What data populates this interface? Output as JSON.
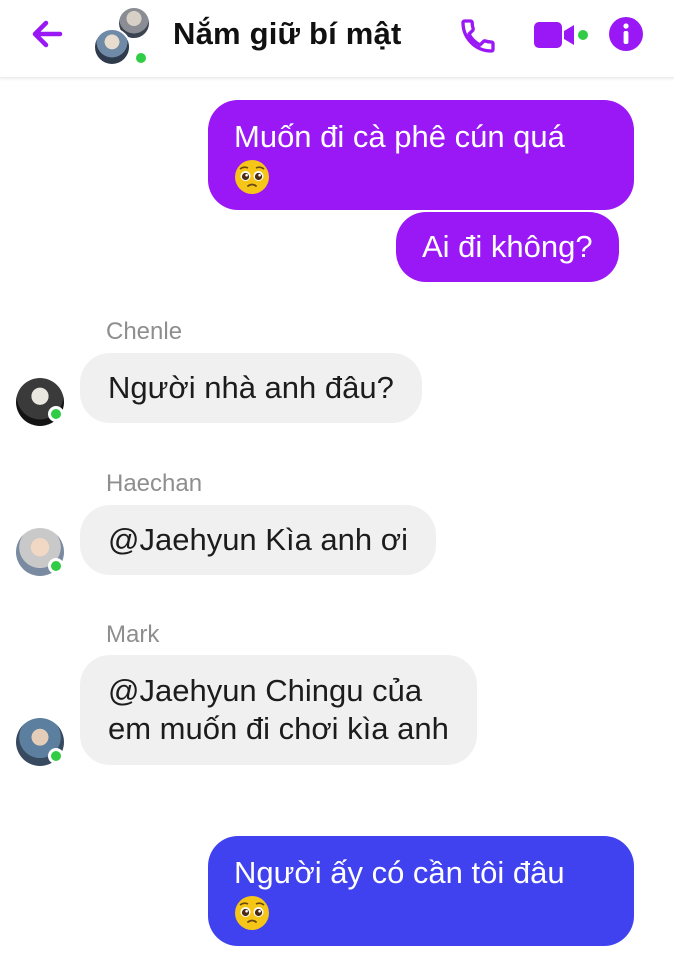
{
  "header": {
    "title": "Nắm giữ bí mật",
    "accent_color": "#9b18f6",
    "icons": [
      "back-arrow-icon",
      "phone-icon",
      "video-camera-icon",
      "info-icon"
    ]
  },
  "messages": [
    {
      "type": "outgoing",
      "color": "#9b18f6",
      "lines": [
        "Muốn đi cà phê cún quá"
      ],
      "emoji": "pleading-face-emoji"
    },
    {
      "type": "outgoing",
      "color": "#9b18f6",
      "lines": [
        "Ai đi không?"
      ]
    },
    {
      "type": "incoming",
      "sender": "Chenle",
      "lines": [
        "Người nhà anh đâu?"
      ]
    },
    {
      "type": "incoming",
      "sender": "Haechan",
      "lines": [
        "@Jaehyun Kìa anh ơi"
      ]
    },
    {
      "type": "incoming",
      "sender": "Mark",
      "lines": [
        "@Jaehyun Chingu của",
        "em muốn đi chơi kìa anh"
      ]
    },
    {
      "type": "outgoing",
      "color": "#4042f0",
      "lines": [
        "Người ấy có cần tôi đâu"
      ],
      "emoji": "pleading-face-emoji"
    }
  ]
}
